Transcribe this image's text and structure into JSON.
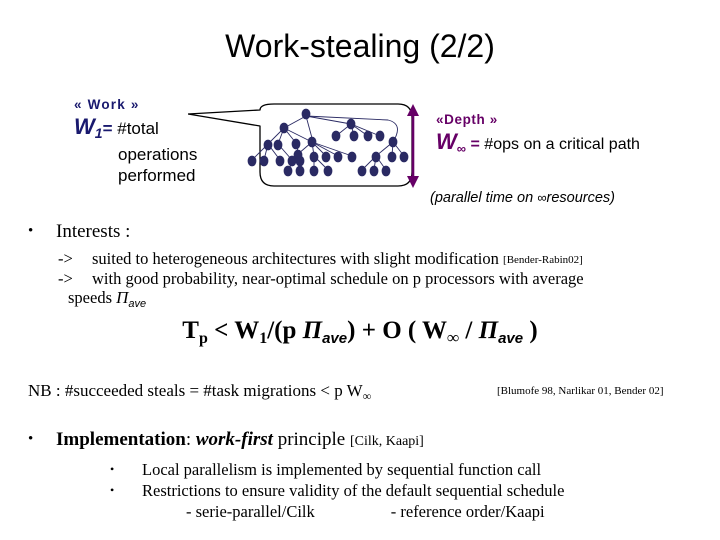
{
  "slide": {
    "title": "Work-stealing (2/2)"
  },
  "colors": {
    "navy": "#19196E",
    "purple": "#660066",
    "text": "#000000",
    "background": "#FFFFFF"
  },
  "work_block": {
    "label": "« Work »",
    "symbol": "W",
    "subscript": "1",
    "equals": "=",
    "definition_line1": "#total",
    "definition_line2": "operations",
    "definition_line3": "performed"
  },
  "depth_block": {
    "label": "«Depth »",
    "symbol": "W",
    "subscript": "∞",
    "equals": "=",
    "definition": "#ops on a critical path",
    "note_prefix": "(parallel time on",
    "note_infinity": "∞",
    "note_suffix": "resources)"
  },
  "diagram": {
    "name": "task-tree-callout",
    "arrow_name": "depth-double-arrow"
  },
  "interests": {
    "bullet": "•",
    "heading": "Interests :",
    "items": [
      {
        "arrow": "->",
        "text": "suited to heterogeneous architectures with slight modification",
        "reference": "[Bender-Rabin02]"
      },
      {
        "arrow": "->",
        "text": "with good probability, near-optimal schedule on p processors with average",
        "reference": ""
      }
    ],
    "continuation_prefix": "speeds",
    "continuation_pi": "Π",
    "continuation_sub": "ave"
  },
  "formula": {
    "t": "T",
    "t_sub": "p",
    "lt": "<",
    "w1": "W",
    "w1_sub": "1",
    "div_open": "/(p",
    "pi1": "Π",
    "pi1_sub": "ave",
    "close1": ")",
    "plus": "+",
    "big_o": "O (",
    "winf": "W",
    "winf_sub": "∞",
    "slash": "/",
    "pi2": "Π",
    "pi2_sub": "ave",
    "close2": ")"
  },
  "nb": {
    "text_prefix": "NB : #succeeded steals = #task migrations  < p W",
    "infinity": "∞",
    "reference": "[Blumofe 98, Narlikar 01, Bender 02]"
  },
  "implementation": {
    "bullet": "•",
    "label": "Implementation",
    "colon": ": ",
    "emphasis": "work-first",
    "rest": " principle ",
    "reference": "[Cilk, Kaapi]",
    "sub_items": [
      {
        "bullet": "•",
        "text": "Local parallelism is implemented by sequential function call"
      },
      {
        "bullet": "•",
        "text": "Restrictions to ensure validity of the default sequential schedule"
      }
    ],
    "footnote_left": "- serie-parallel/Cilk",
    "footnote_right": "-  reference order/Kaapi"
  }
}
